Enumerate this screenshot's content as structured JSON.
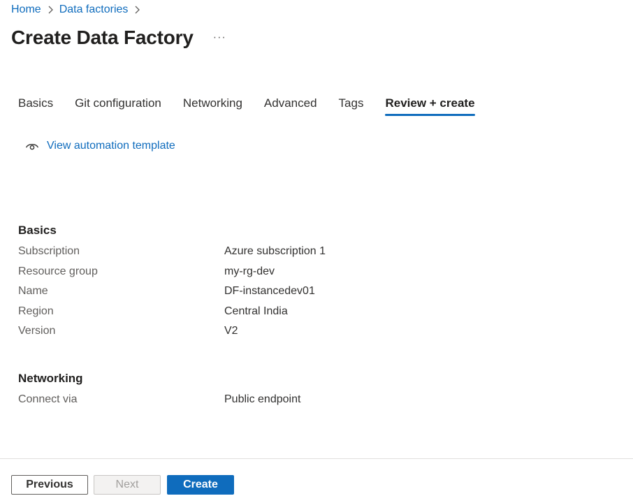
{
  "breadcrumb": {
    "items": [
      {
        "label": "Home"
      },
      {
        "label": "Data factories"
      }
    ],
    "separator_icon": "chevron-right-icon"
  },
  "header": {
    "title": "Create Data Factory",
    "more_label": "···"
  },
  "tabs": [
    {
      "label": "Basics",
      "active": false
    },
    {
      "label": "Git configuration",
      "active": false
    },
    {
      "label": "Networking",
      "active": false
    },
    {
      "label": "Advanced",
      "active": false
    },
    {
      "label": "Tags",
      "active": false
    },
    {
      "label": "Review + create",
      "active": true
    }
  ],
  "automation": {
    "icon": "eye-icon",
    "label": "View automation template"
  },
  "review": {
    "basics": {
      "title": "Basics",
      "rows": [
        {
          "label": "Subscription",
          "value": "Azure subscription 1"
        },
        {
          "label": "Resource group",
          "value": "my-rg-dev"
        },
        {
          "label": "Name",
          "value": "DF-instancedev01"
        },
        {
          "label": "Region",
          "value": "Central India"
        },
        {
          "label": "Version",
          "value": "V2"
        }
      ]
    },
    "networking": {
      "title": "Networking",
      "rows": [
        {
          "label": "Connect via",
          "value": "Public endpoint"
        }
      ]
    }
  },
  "footer": {
    "previous_label": "Previous",
    "next_label": "Next",
    "create_label": "Create"
  },
  "colors": {
    "accent": "#0f6cbd",
    "text": "#323130",
    "label": "#605e5c",
    "disabled_bg": "#f3f2f1"
  }
}
